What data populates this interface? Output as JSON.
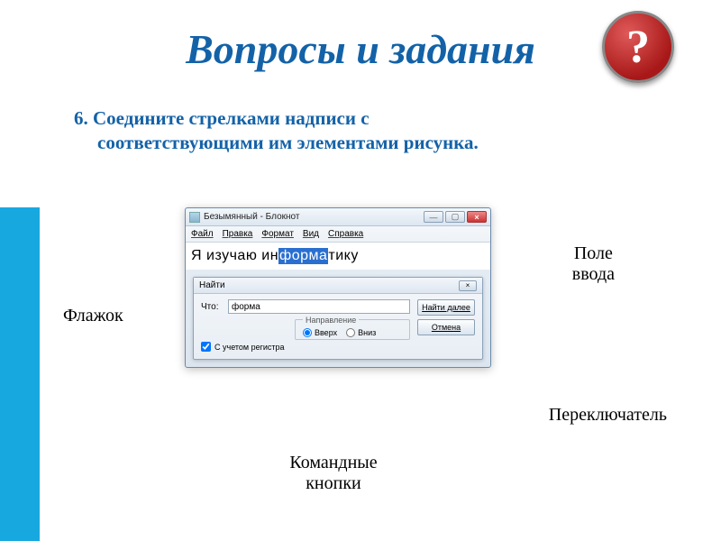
{
  "title": "Вопросы и задания",
  "badge": "?",
  "instruction_first": "6. Соедините стрелками надписи с",
  "instruction_rest": "соответствующими им элементами рисунка.",
  "labels": {
    "flag": "Флажок",
    "field_line1": "Поле",
    "field_line2": "ввода",
    "switch": "Переключатель",
    "cmd_line1": "Командные",
    "cmd_line2": "кнопки"
  },
  "notepad": {
    "title": "Безымянный - Блокнот",
    "menu": {
      "file": "Файл",
      "edit": "Правка",
      "format": "Формат",
      "view": "Вид",
      "help": "Справка"
    },
    "text_before": "Я изучаю ин",
    "text_selected": "форма",
    "text_after": "тику",
    "win_min": "—",
    "win_max": "▢",
    "win_close": "×"
  },
  "find": {
    "title": "Найти",
    "close": "×",
    "what_label": "Что:",
    "what_value": "форма",
    "direction_legend": "Направление",
    "up": "Вверх",
    "down": "Вниз",
    "case": "С учетом регистра",
    "btn_next": "Найти далее",
    "btn_cancel": "Отмена"
  }
}
